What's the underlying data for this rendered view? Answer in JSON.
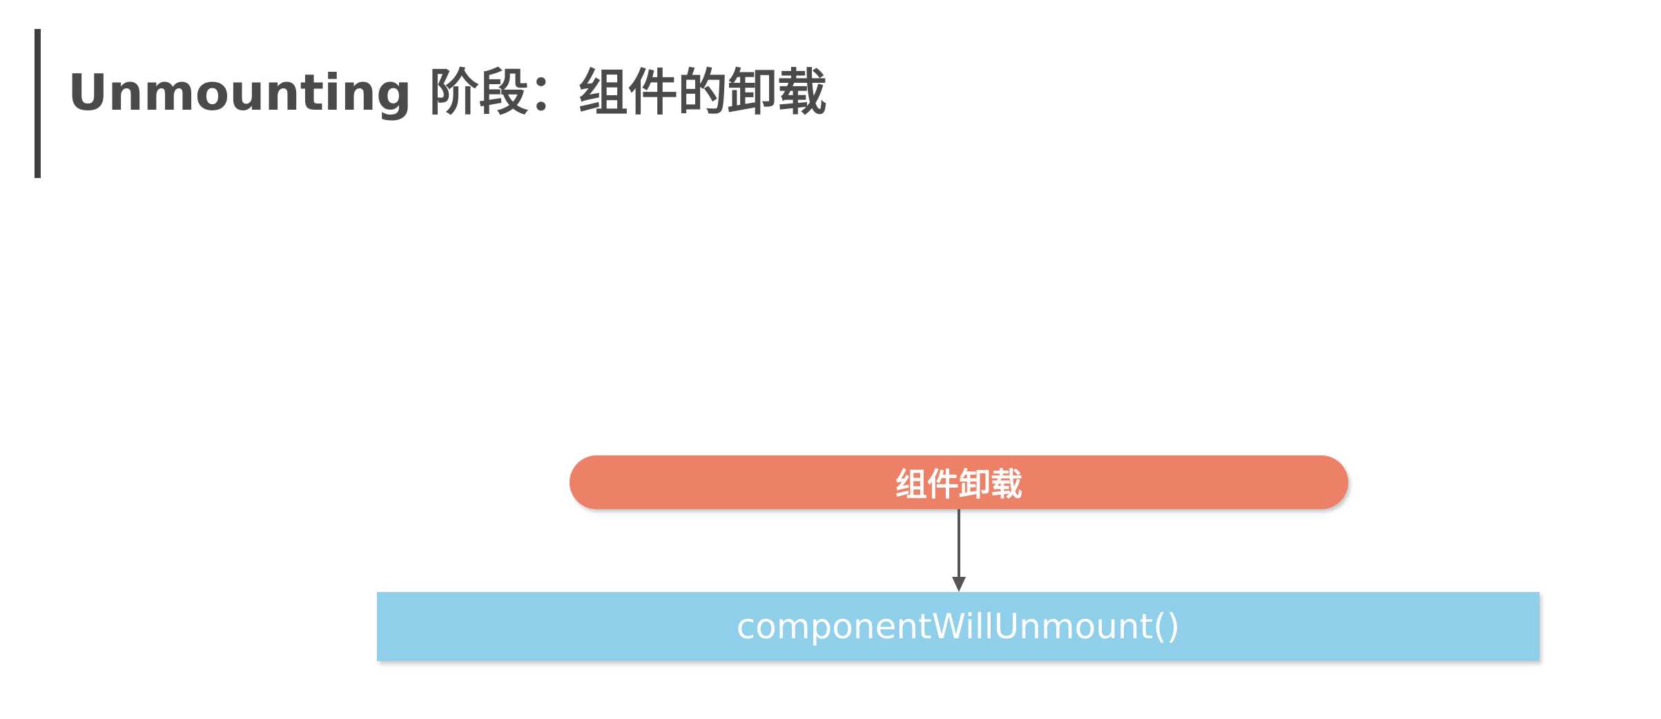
{
  "slide": {
    "title": "Unmounting 阶段：组件的卸载"
  },
  "diagram": {
    "event_label": "组件卸载",
    "lifecycle_method": "componentWillUnmount()"
  },
  "colors": {
    "title_text": "#4a4a4a",
    "title_bar": "#3f3f3f",
    "event_pill": "#ed8167",
    "lifecycle_box": "#8fcfe9",
    "arrow": "#555555"
  }
}
